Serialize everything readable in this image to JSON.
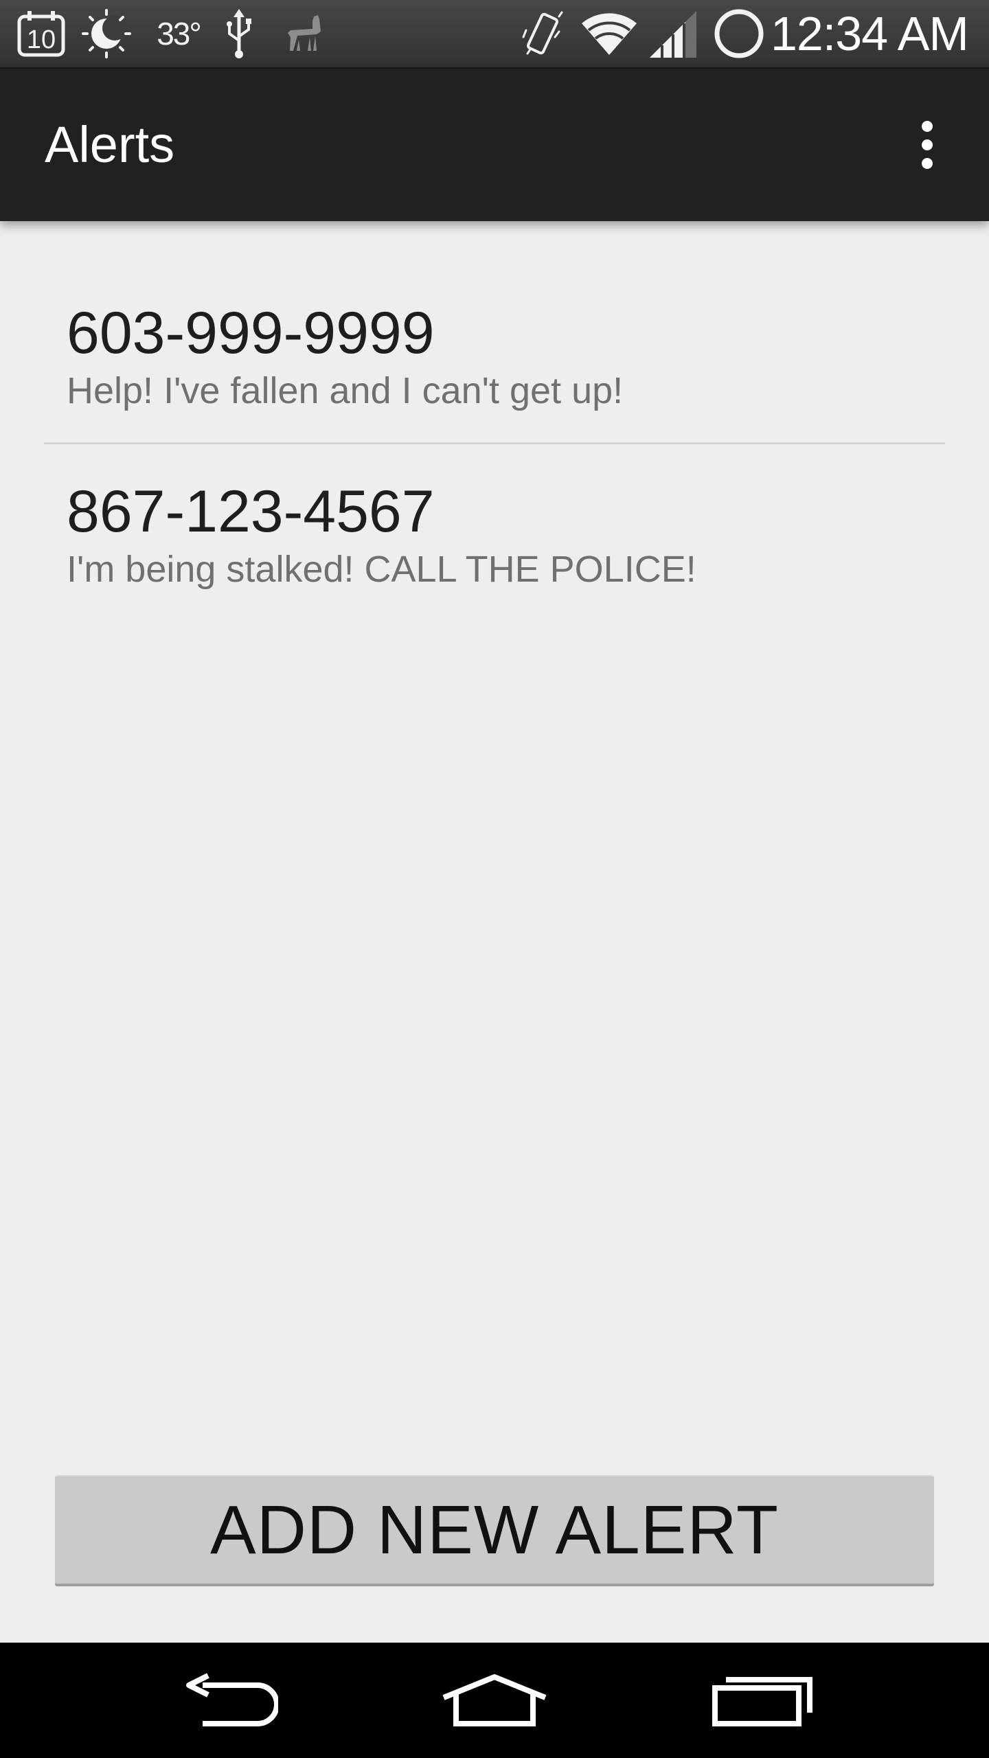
{
  "status_bar": {
    "icons": [
      "calendar-icon",
      "weather-moon-icon",
      "usb-icon",
      "llama-icon",
      "vibrate-icon",
      "wifi-icon",
      "cell-signal-icon",
      "battery-ring-icon"
    ],
    "calendar_day": "10",
    "temperature": "33°",
    "time": "12:34 AM"
  },
  "action_bar": {
    "title": "Alerts",
    "overflow_icon": "overflow-menu-icon"
  },
  "alerts": [
    {
      "phone": "603-999-9999",
      "message": "Help! I've fallen and I can't get up!"
    },
    {
      "phone": "867-123-4567",
      "message": "I'm being stalked! CALL THE POLICE!"
    }
  ],
  "add_button": {
    "label": "ADD NEW ALERT"
  },
  "nav_bar": {
    "buttons": [
      "back-icon",
      "home-icon",
      "recent-apps-icon"
    ]
  },
  "colors": {
    "status_bar": "#3c3c3c",
    "action_bar": "#212121",
    "background": "#eeeeee",
    "button": "#cacaca",
    "nav_bar": "#000000"
  }
}
